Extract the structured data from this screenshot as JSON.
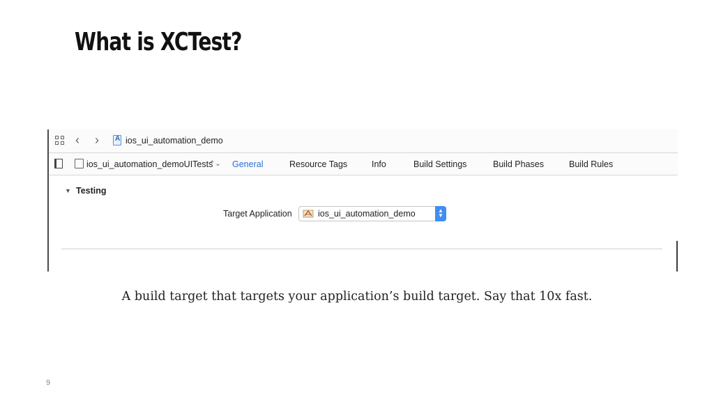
{
  "slide": {
    "title": "What is XCTest?",
    "caption": "A build target that targets your application’s build target. Say that 10x fast.",
    "page_number": "9"
  },
  "xcode": {
    "jump_bar": {
      "back_glyph": "‹",
      "forward_glyph": "›",
      "project_name": "ios_ui_automation_demo"
    },
    "target_selector": {
      "target_name": "ios_ui_automation_demoUITests",
      "stepper_glyph": "⌃⌄"
    },
    "tabs": [
      {
        "label": "General",
        "active": true
      },
      {
        "label": "Resource Tags",
        "active": false
      },
      {
        "label": "Info",
        "active": false
      },
      {
        "label": "Build Settings",
        "active": false
      },
      {
        "label": "Build Phases",
        "active": false
      },
      {
        "label": "Build Rules",
        "active": false
      }
    ],
    "testing_section": {
      "disclosure_glyph": "▼",
      "header": "Testing",
      "target_application_label": "Target Application",
      "target_application_value": "ios_ui_automation_demo"
    }
  },
  "colors": {
    "active_tab": "#2d6fd6",
    "popup_stepper": "#3f8ef5"
  },
  "icons": [
    "grid-icon",
    "chevron-left-icon",
    "chevron-right-icon",
    "project-file-icon",
    "sidebar-toggle-icon",
    "folder-icon",
    "disclosure-triangle-icon",
    "app-icon",
    "popup-stepper-icon"
  ]
}
